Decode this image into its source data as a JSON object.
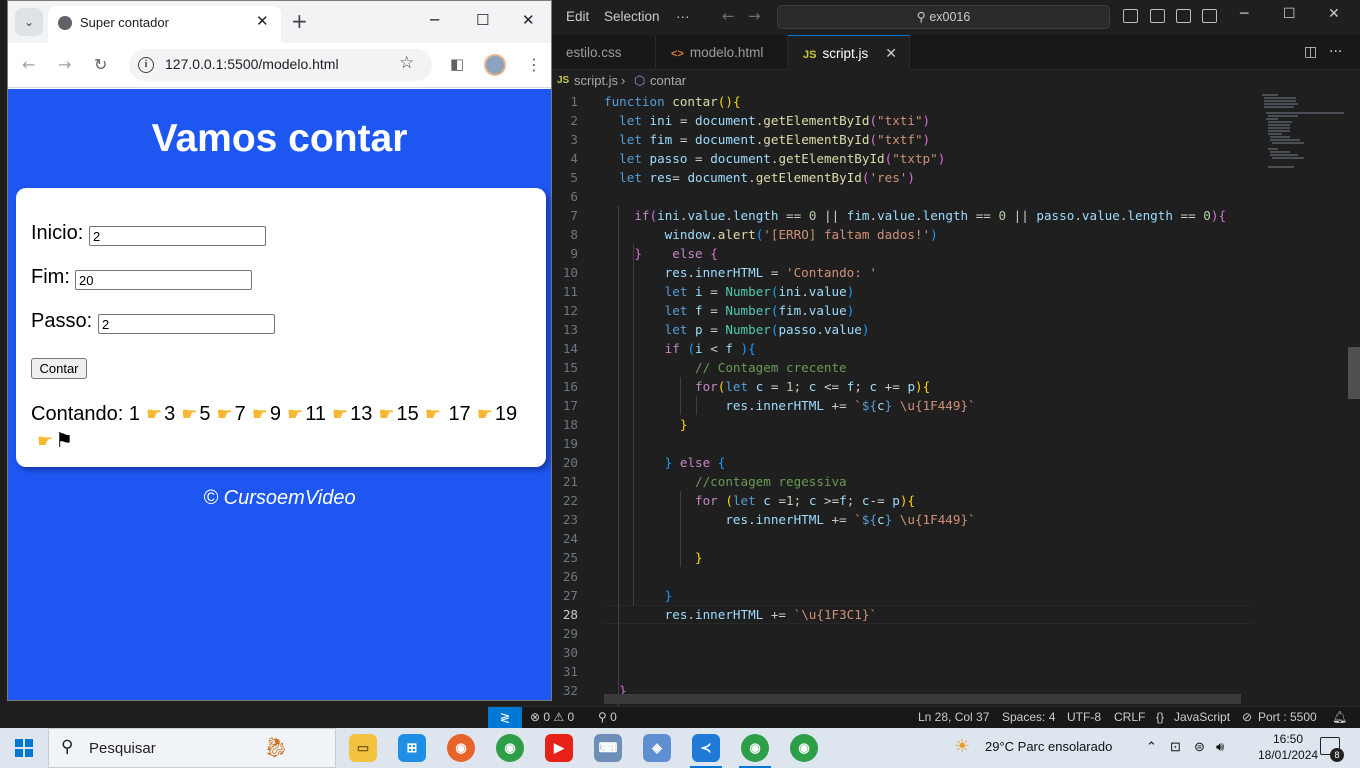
{
  "browser": {
    "tab_title": "Super contador",
    "url": "127.0.0.1:5500/modelo.html",
    "page": {
      "title": "Vamos contar",
      "inicio_label": "Inicio:",
      "inicio_value": "2",
      "fim_label": "Fim:",
      "fim_value": "20",
      "passo_label": "Passo:",
      "passo_value": "2",
      "button_label": "Contar",
      "result_prefix": "Contando:",
      "result_numbers": [
        "1",
        "3",
        "5",
        "7",
        "9",
        "11",
        "13",
        "15",
        "17",
        "19"
      ],
      "footer": "© CursoemVideo"
    }
  },
  "editor": {
    "menu": [
      "Edit",
      "Selection",
      "···"
    ],
    "search_text": "ex0016",
    "tabs": [
      {
        "label": "estilo.css",
        "icon": "#"
      },
      {
        "label": "modelo.html",
        "icon": "<>"
      },
      {
        "label": "script.js",
        "icon": "JS"
      }
    ],
    "breadcrumb": {
      "file": "script.js",
      "symbol": "contar"
    },
    "line_numbers": [
      "1",
      "2",
      "3",
      "4",
      "5",
      "6",
      "7",
      "8",
      "9",
      "10",
      "11",
      "12",
      "13",
      "14",
      "15",
      "16",
      "17",
      "18",
      "19",
      "20",
      "21",
      "22",
      "23",
      "24",
      "25",
      "26",
      "27",
      "28",
      "29",
      "30",
      "31",
      "32"
    ],
    "status": {
      "problems": "⊗ 0 ⚠ 0",
      "ports": "⚲ 0",
      "position": "Ln 28, Col 37",
      "spaces": "Spaces: 4",
      "encoding": "UTF-8",
      "eol": "CRLF",
      "language": "JavaScript",
      "port": "Port : 5500"
    }
  },
  "taskbar": {
    "search_placeholder": "Pesquisar",
    "weather": "29°C  Parc ensolarado",
    "time": "16:50",
    "date": "18/01/2024",
    "notifications": "8"
  }
}
